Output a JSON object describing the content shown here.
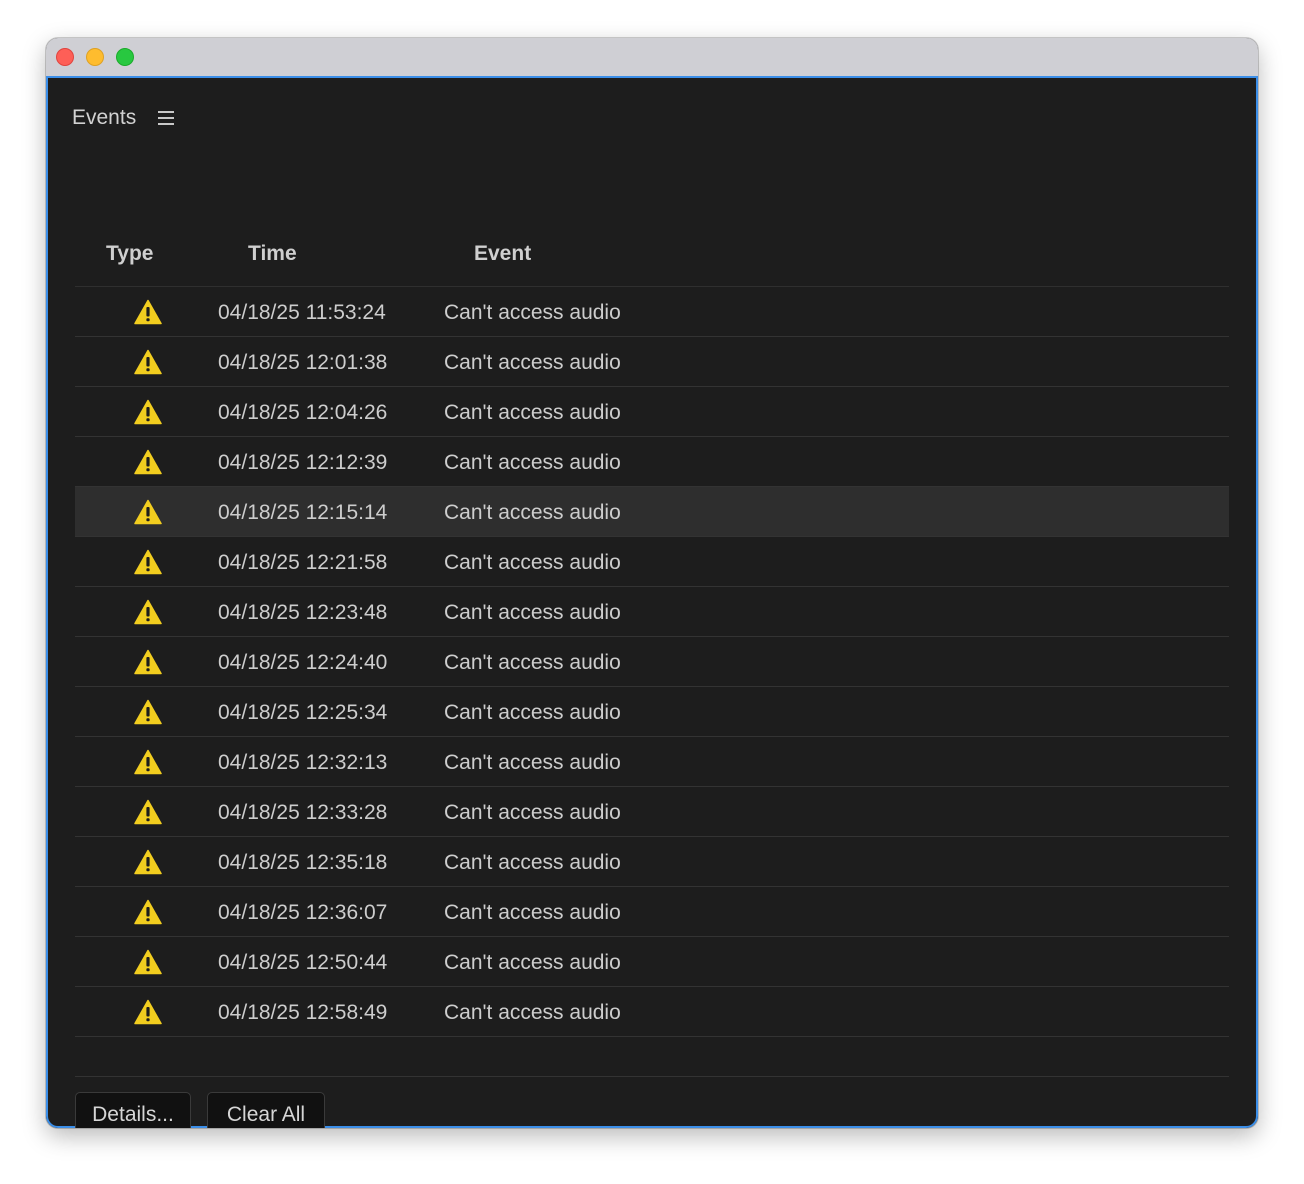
{
  "panel": {
    "title": "Events"
  },
  "icons": {
    "menu": "hamburger-menu-icon",
    "warning": "warning-triangle-icon"
  },
  "colors": {
    "warning": "#f2cd1f",
    "focus_border": "#3b8ee8",
    "background": "#1d1d1d",
    "selected_row": "#2e2e2e"
  },
  "table": {
    "headers": {
      "type": "Type",
      "time": "Time",
      "event": "Event"
    },
    "selected_index": 4,
    "rows": [
      {
        "type": "warning",
        "time": "04/18/25 11:53:24",
        "event": "Can't access audio"
      },
      {
        "type": "warning",
        "time": "04/18/25 12:01:38",
        "event": "Can't access audio"
      },
      {
        "type": "warning",
        "time": "04/18/25 12:04:26",
        "event": "Can't access audio"
      },
      {
        "type": "warning",
        "time": "04/18/25 12:12:39",
        "event": "Can't access audio"
      },
      {
        "type": "warning",
        "time": "04/18/25 12:15:14",
        "event": "Can't access audio"
      },
      {
        "type": "warning",
        "time": "04/18/25 12:21:58",
        "event": "Can't access audio"
      },
      {
        "type": "warning",
        "time": "04/18/25 12:23:48",
        "event": "Can't access audio"
      },
      {
        "type": "warning",
        "time": "04/18/25 12:24:40",
        "event": "Can't access audio"
      },
      {
        "type": "warning",
        "time": "04/18/25 12:25:34",
        "event": "Can't access audio"
      },
      {
        "type": "warning",
        "time": "04/18/25 12:32:13",
        "event": "Can't access audio"
      },
      {
        "type": "warning",
        "time": "04/18/25 12:33:28",
        "event": "Can't access audio"
      },
      {
        "type": "warning",
        "time": "04/18/25 12:35:18",
        "event": "Can't access audio"
      },
      {
        "type": "warning",
        "time": "04/18/25 12:36:07",
        "event": "Can't access audio"
      },
      {
        "type": "warning",
        "time": "04/18/25 12:50:44",
        "event": "Can't access audio"
      },
      {
        "type": "warning",
        "time": "04/18/25 12:58:49",
        "event": "Can't access audio"
      }
    ]
  },
  "buttons": {
    "details": "Details...",
    "clear_all": "Clear All"
  }
}
